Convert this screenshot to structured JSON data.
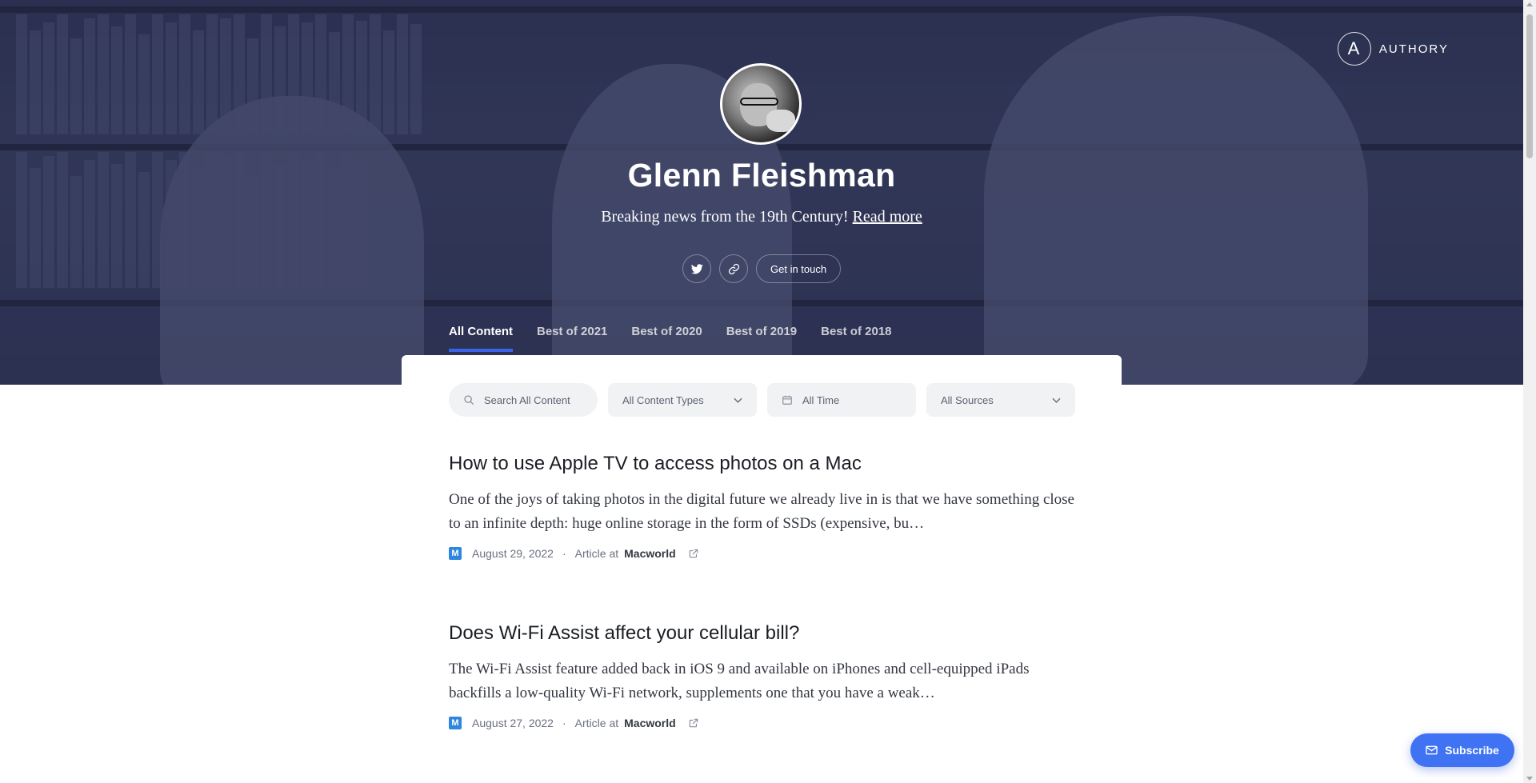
{
  "brand": {
    "name": "AUTHORY",
    "icon": "authory-logo-icon"
  },
  "profile": {
    "name": "Glenn Fleishman",
    "tagline": "Breaking news from the 19th Century!",
    "read_more": "Read more",
    "avatar_icon": "avatar-portrait"
  },
  "social": {
    "twitter_icon": "twitter-icon",
    "link_icon": "link-icon",
    "contact_label": "Get in touch"
  },
  "tabs": [
    {
      "label": "All Content",
      "active": true
    },
    {
      "label": "Best of 2021",
      "active": false
    },
    {
      "label": "Best of 2020",
      "active": false
    },
    {
      "label": "Best of 2019",
      "active": false
    },
    {
      "label": "Best of 2018",
      "active": false
    }
  ],
  "filters": {
    "search_placeholder": "Search All Content",
    "types": "All Content Types",
    "time": "All Time",
    "sources": "All Sources"
  },
  "articles": [
    {
      "title": "How to use Apple TV to access photos on a Mac",
      "excerpt": "One of the joys of taking photos in the digital future we already live in is that we have something close to an infinite depth: huge online storage in the form of SSDs (expensive, bu…",
      "date": "August 29, 2022",
      "type": "Article at",
      "source": "Macworld",
      "source_logo": "M"
    },
    {
      "title": "Does Wi-Fi Assist affect your cellular bill?",
      "excerpt": "The Wi-Fi Assist feature added back in iOS 9 and available on iPhones and cell-equipped iPads backfills a low-quality Wi-Fi network, supplements one that you have a weak…",
      "date": "August 27, 2022",
      "type": "Article at",
      "source": "Macworld",
      "source_logo": "M"
    }
  ],
  "subscribe": {
    "label": "Subscribe",
    "icon": "mail-icon"
  },
  "colors": {
    "accent": "#3f73f3",
    "tab_underline": "#3a63e8",
    "hero_tint": "#2c3150"
  }
}
